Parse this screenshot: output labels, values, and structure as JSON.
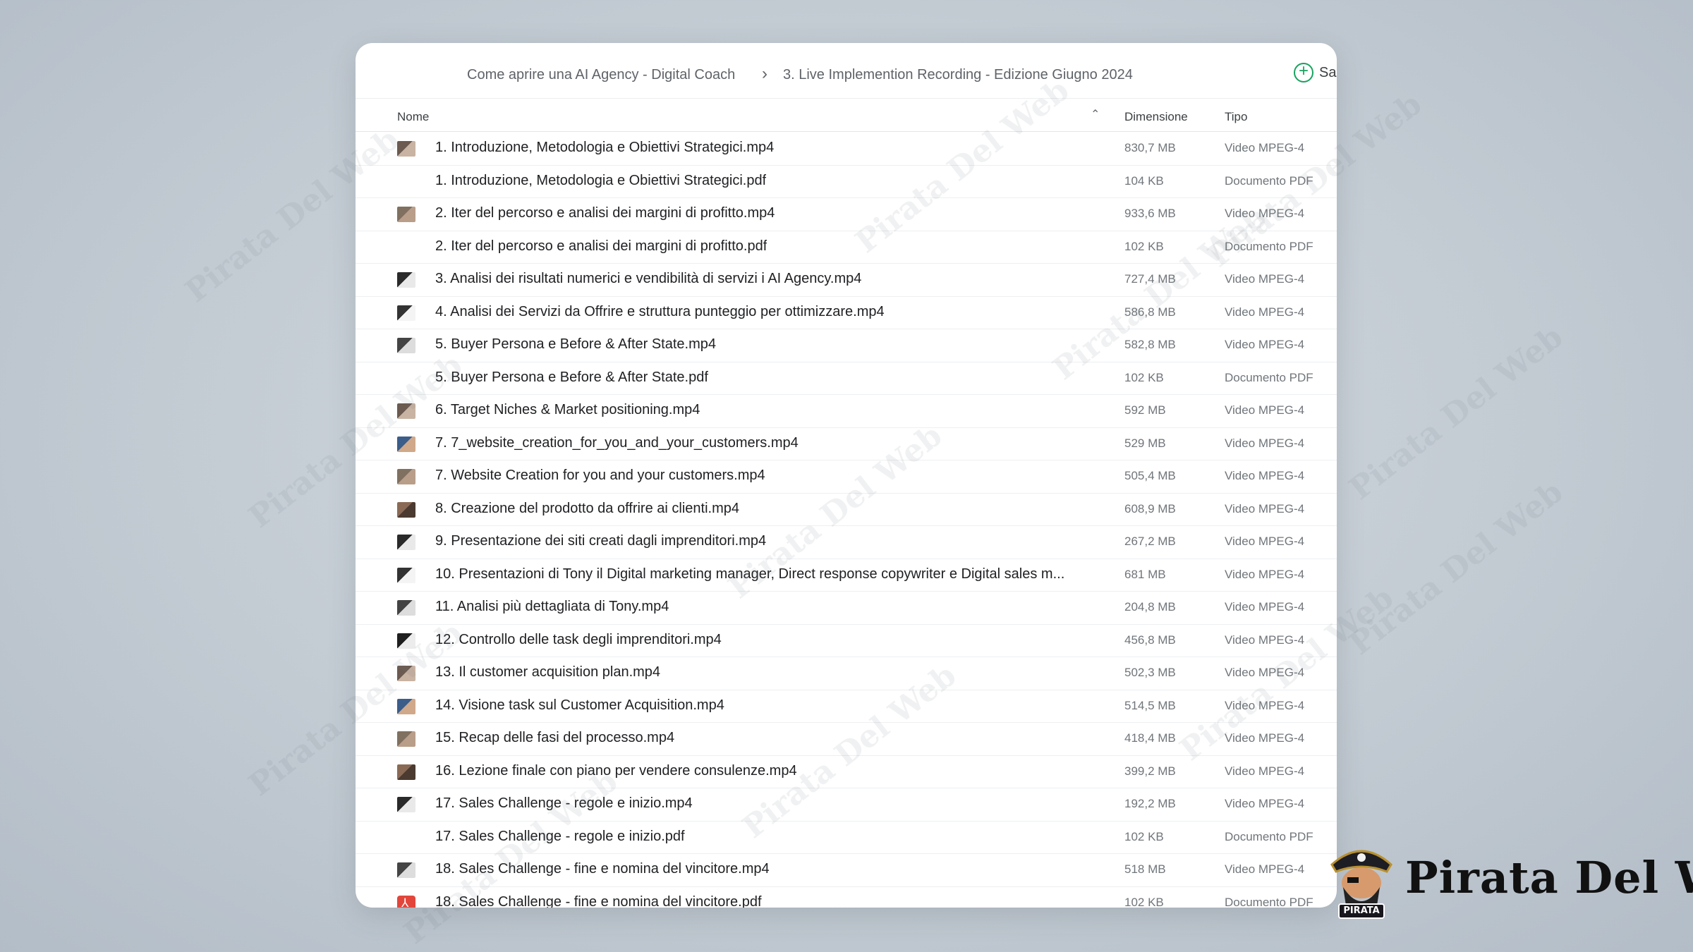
{
  "breadcrumb": {
    "items": [
      "Come aprire una AI Agency - Digital Coach",
      "3. Live Implemention Recording - Edizione Giugno 2024"
    ],
    "separator": "›"
  },
  "toolbar": {
    "add_label": "Sa"
  },
  "columns": {
    "name": "Nome",
    "size": "Dimensione",
    "type": "Tipo"
  },
  "files": [
    {
      "name": "1. Introduzione, Metodologia e Obiettivi Strategici.mp4",
      "size": "830,7 MB",
      "type": "Video MPEG-4",
      "thumb": "video"
    },
    {
      "name": "1. Introduzione, Metodologia e Obiettivi Strategici.pdf",
      "size": "104 KB",
      "type": "Documento PDF",
      "thumb": "none"
    },
    {
      "name": "2. Iter del percorso e analisi dei margini di profitto.mp4",
      "size": "933,6 MB",
      "type": "Video MPEG-4",
      "thumb": "video"
    },
    {
      "name": "2. Iter del percorso e analisi dei margini di profitto.pdf",
      "size": "102 KB",
      "type": "Documento PDF",
      "thumb": "none"
    },
    {
      "name": "3. Analisi dei risultati numerici e vendibilità di servizi i AI Agency.mp4",
      "size": "727,4 MB",
      "type": "Video MPEG-4",
      "thumb": "video"
    },
    {
      "name": "4. Analisi dei Servizi da Offrire e struttura punteggio per ottimizzare.mp4",
      "size": "586,8 MB",
      "type": "Video MPEG-4",
      "thumb": "video"
    },
    {
      "name": "5. Buyer Persona e Before & After State.mp4",
      "size": "582,8 MB",
      "type": "Video MPEG-4",
      "thumb": "video"
    },
    {
      "name": "5. Buyer Persona e Before & After State.pdf",
      "size": "102 KB",
      "type": "Documento PDF",
      "thumb": "none"
    },
    {
      "name": "6. Target Niches & Market positioning.mp4",
      "size": "592 MB",
      "type": "Video MPEG-4",
      "thumb": "video"
    },
    {
      "name": "7. 7_website_creation_for_you_and_your_customers.mp4",
      "size": "529 MB",
      "type": "Video MPEG-4",
      "thumb": "video"
    },
    {
      "name": "7. Website Creation for you and your customers.mp4",
      "size": "505,4 MB",
      "type": "Video MPEG-4",
      "thumb": "video"
    },
    {
      "name": "8. Creazione del prodotto da offrire ai clienti.mp4",
      "size": "608,9 MB",
      "type": "Video MPEG-4",
      "thumb": "video"
    },
    {
      "name": "9. Presentazione dei siti creati dagli imprenditori.mp4",
      "size": "267,2 MB",
      "type": "Video MPEG-4",
      "thumb": "video"
    },
    {
      "name": "10. Presentazioni di Tony il Digital marketing manager, Direct response copywriter e Digital sales m...",
      "size": "681 MB",
      "type": "Video MPEG-4",
      "thumb": "video"
    },
    {
      "name": "11. Analisi più dettagliata di Tony.mp4",
      "size": "204,8 MB",
      "type": "Video MPEG-4",
      "thumb": "video"
    },
    {
      "name": "12. Controllo delle task degli imprenditori.mp4",
      "size": "456,8 MB",
      "type": "Video MPEG-4",
      "thumb": "video"
    },
    {
      "name": "13. Il customer acquisition plan.mp4",
      "size": "502,3 MB",
      "type": "Video MPEG-4",
      "thumb": "video"
    },
    {
      "name": "14. Visione task sul Customer Acquisition.mp4",
      "size": "514,5 MB",
      "type": "Video MPEG-4",
      "thumb": "video"
    },
    {
      "name": "15. Recap delle fasi del processo.mp4",
      "size": "418,4 MB",
      "type": "Video MPEG-4",
      "thumb": "video"
    },
    {
      "name": "16. Lezione finale con piano per vendere consulenze.mp4",
      "size": "399,2 MB",
      "type": "Video MPEG-4",
      "thumb": "video"
    },
    {
      "name": "17. Sales Challenge - regole e inizio.mp4",
      "size": "192,2 MB",
      "type": "Video MPEG-4",
      "thumb": "video"
    },
    {
      "name": "17. Sales Challenge - regole e inizio.pdf",
      "size": "102 KB",
      "type": "Documento PDF",
      "thumb": "none"
    },
    {
      "name": "18. Sales Challenge - fine e nomina del vincitore.mp4",
      "size": "518 MB",
      "type": "Video MPEG-4",
      "thumb": "video"
    },
    {
      "name": "18. Sales Challenge - fine e nomina del vincitore.pdf",
      "size": "102 KB",
      "type": "Documento PDF",
      "thumb": "pdf"
    }
  ],
  "brand": {
    "name": "Pirata Del Web",
    "logo_text": "PIRATA"
  },
  "watermark_text": "Pirata Del Web",
  "colors": {
    "accent_green": "#1aa260",
    "pdf_red": "#e2463b",
    "text_dark": "#202124",
    "text_muted": "#70757a"
  }
}
